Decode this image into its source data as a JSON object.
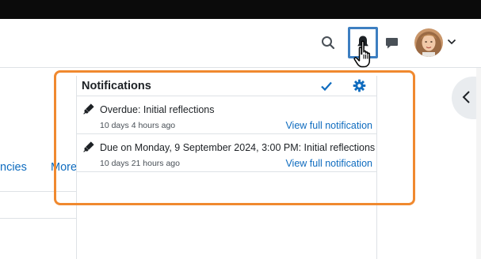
{
  "colors": {
    "accent_link": "#0f6cbf",
    "highlight": "#f0892f",
    "bell_focus": "#3d7fc1",
    "top_bar": "#0b0b0b"
  },
  "navbar": {
    "icons": [
      "search-icon",
      "bell-icon",
      "chat-icon",
      "avatar",
      "chevron-down-icon"
    ]
  },
  "course_nav": {
    "tab_partial_1": "ncies",
    "tab_partial_2": "More"
  },
  "notifications": {
    "title": "Notifications",
    "header_icons": [
      "check-icon",
      "gear-icon"
    ],
    "items": [
      {
        "icon": "marker-icon",
        "text": "Overdue: Initial reflections",
        "time": "10 days 4 hours ago",
        "link": "View full notification"
      },
      {
        "icon": "marker-icon",
        "text": "Due on Monday, 9 September 2024, 3:00 PM: Initial reflections",
        "time": "10 days 21 hours ago",
        "link": "View full notification"
      }
    ]
  },
  "drawer": {
    "toggle_icon": "chevron-left-icon"
  }
}
